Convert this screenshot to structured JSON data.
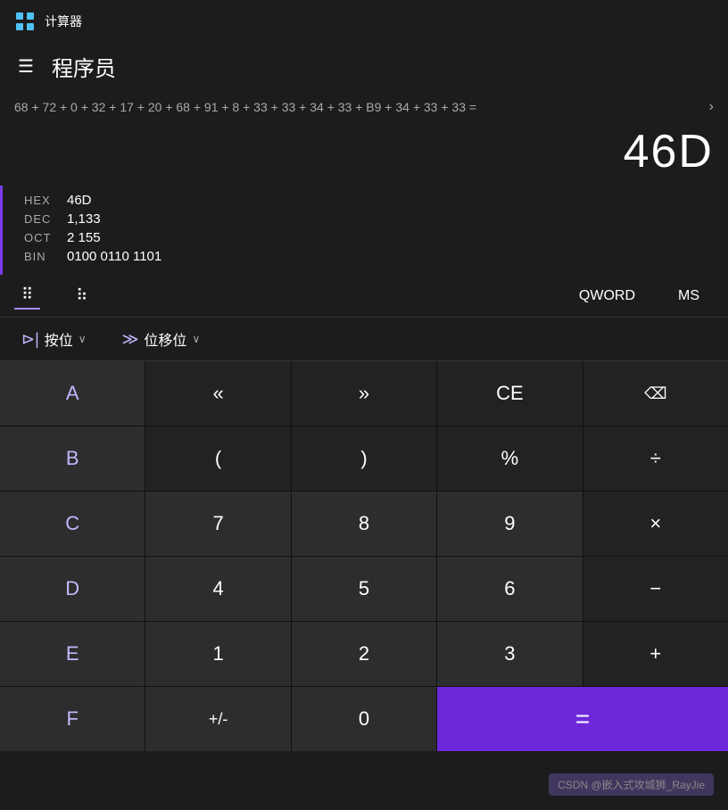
{
  "titleBar": {
    "appName": "计算器"
  },
  "header": {
    "title": "程序员"
  },
  "expression": {
    "text": "68 + 72 + 0 + 32 + 17 + 20 + 68 + 91 + 8 + 33 + 33 + 34 + 33 + B9 + 34 + 33 + 33 =",
    "arrow": "›"
  },
  "result": {
    "value": "46D"
  },
  "conversions": [
    {
      "label": "HEX",
      "value": "46D"
    },
    {
      "label": "DEC",
      "value": "1,133"
    },
    {
      "label": "OCT",
      "value": "2 155"
    },
    {
      "label": "BIN",
      "value": "0100 0110 1101"
    }
  ],
  "toolbar": {
    "qword_label": "QWORD",
    "ms_label": "MS"
  },
  "bitOps": {
    "andor_label": "按位",
    "andor_chevron": "∨",
    "shift_label": "位移位",
    "shift_chevron": "∨"
  },
  "buttons": [
    {
      "id": "A",
      "label": "A",
      "type": "hex-letter"
    },
    {
      "id": "lshift",
      "label": "«",
      "type": "dark"
    },
    {
      "id": "rshift",
      "label": "»",
      "type": "dark"
    },
    {
      "id": "CE",
      "label": "CE",
      "type": "dark"
    },
    {
      "id": "backspace",
      "label": "⌫",
      "type": "dark"
    },
    {
      "id": "B",
      "label": "B",
      "type": "hex-letter"
    },
    {
      "id": "lparen",
      "label": "(",
      "type": "dark"
    },
    {
      "id": "rparen",
      "label": ")",
      "type": "dark"
    },
    {
      "id": "percent",
      "label": "%",
      "type": "dark"
    },
    {
      "id": "divide",
      "label": "÷",
      "type": "dark"
    },
    {
      "id": "C",
      "label": "C",
      "type": "hex-letter"
    },
    {
      "id": "7",
      "label": "7",
      "type": "normal"
    },
    {
      "id": "8",
      "label": "8",
      "type": "normal"
    },
    {
      "id": "9",
      "label": "9",
      "type": "normal"
    },
    {
      "id": "multiply",
      "label": "×",
      "type": "dark"
    },
    {
      "id": "D",
      "label": "D",
      "type": "hex-letter"
    },
    {
      "id": "4",
      "label": "4",
      "type": "normal"
    },
    {
      "id": "5",
      "label": "5",
      "type": "normal"
    },
    {
      "id": "6",
      "label": "6",
      "type": "normal"
    },
    {
      "id": "minus",
      "label": "−",
      "type": "dark"
    },
    {
      "id": "E",
      "label": "E",
      "type": "hex-letter"
    },
    {
      "id": "1",
      "label": "1",
      "type": "normal"
    },
    {
      "id": "2",
      "label": "2",
      "type": "normal"
    },
    {
      "id": "3",
      "label": "3",
      "type": "normal"
    },
    {
      "id": "plus",
      "label": "+",
      "type": "dark"
    },
    {
      "id": "F",
      "label": "F",
      "type": "hex-letter"
    },
    {
      "id": "plusminus",
      "label": "+/-",
      "type": "normal"
    },
    {
      "id": "0",
      "label": "0",
      "type": "normal"
    },
    {
      "id": "equals",
      "label": "=",
      "type": "equals"
    }
  ],
  "watermark": {
    "text": "CSDN @嵌入式攻城狮_RayJie"
  }
}
